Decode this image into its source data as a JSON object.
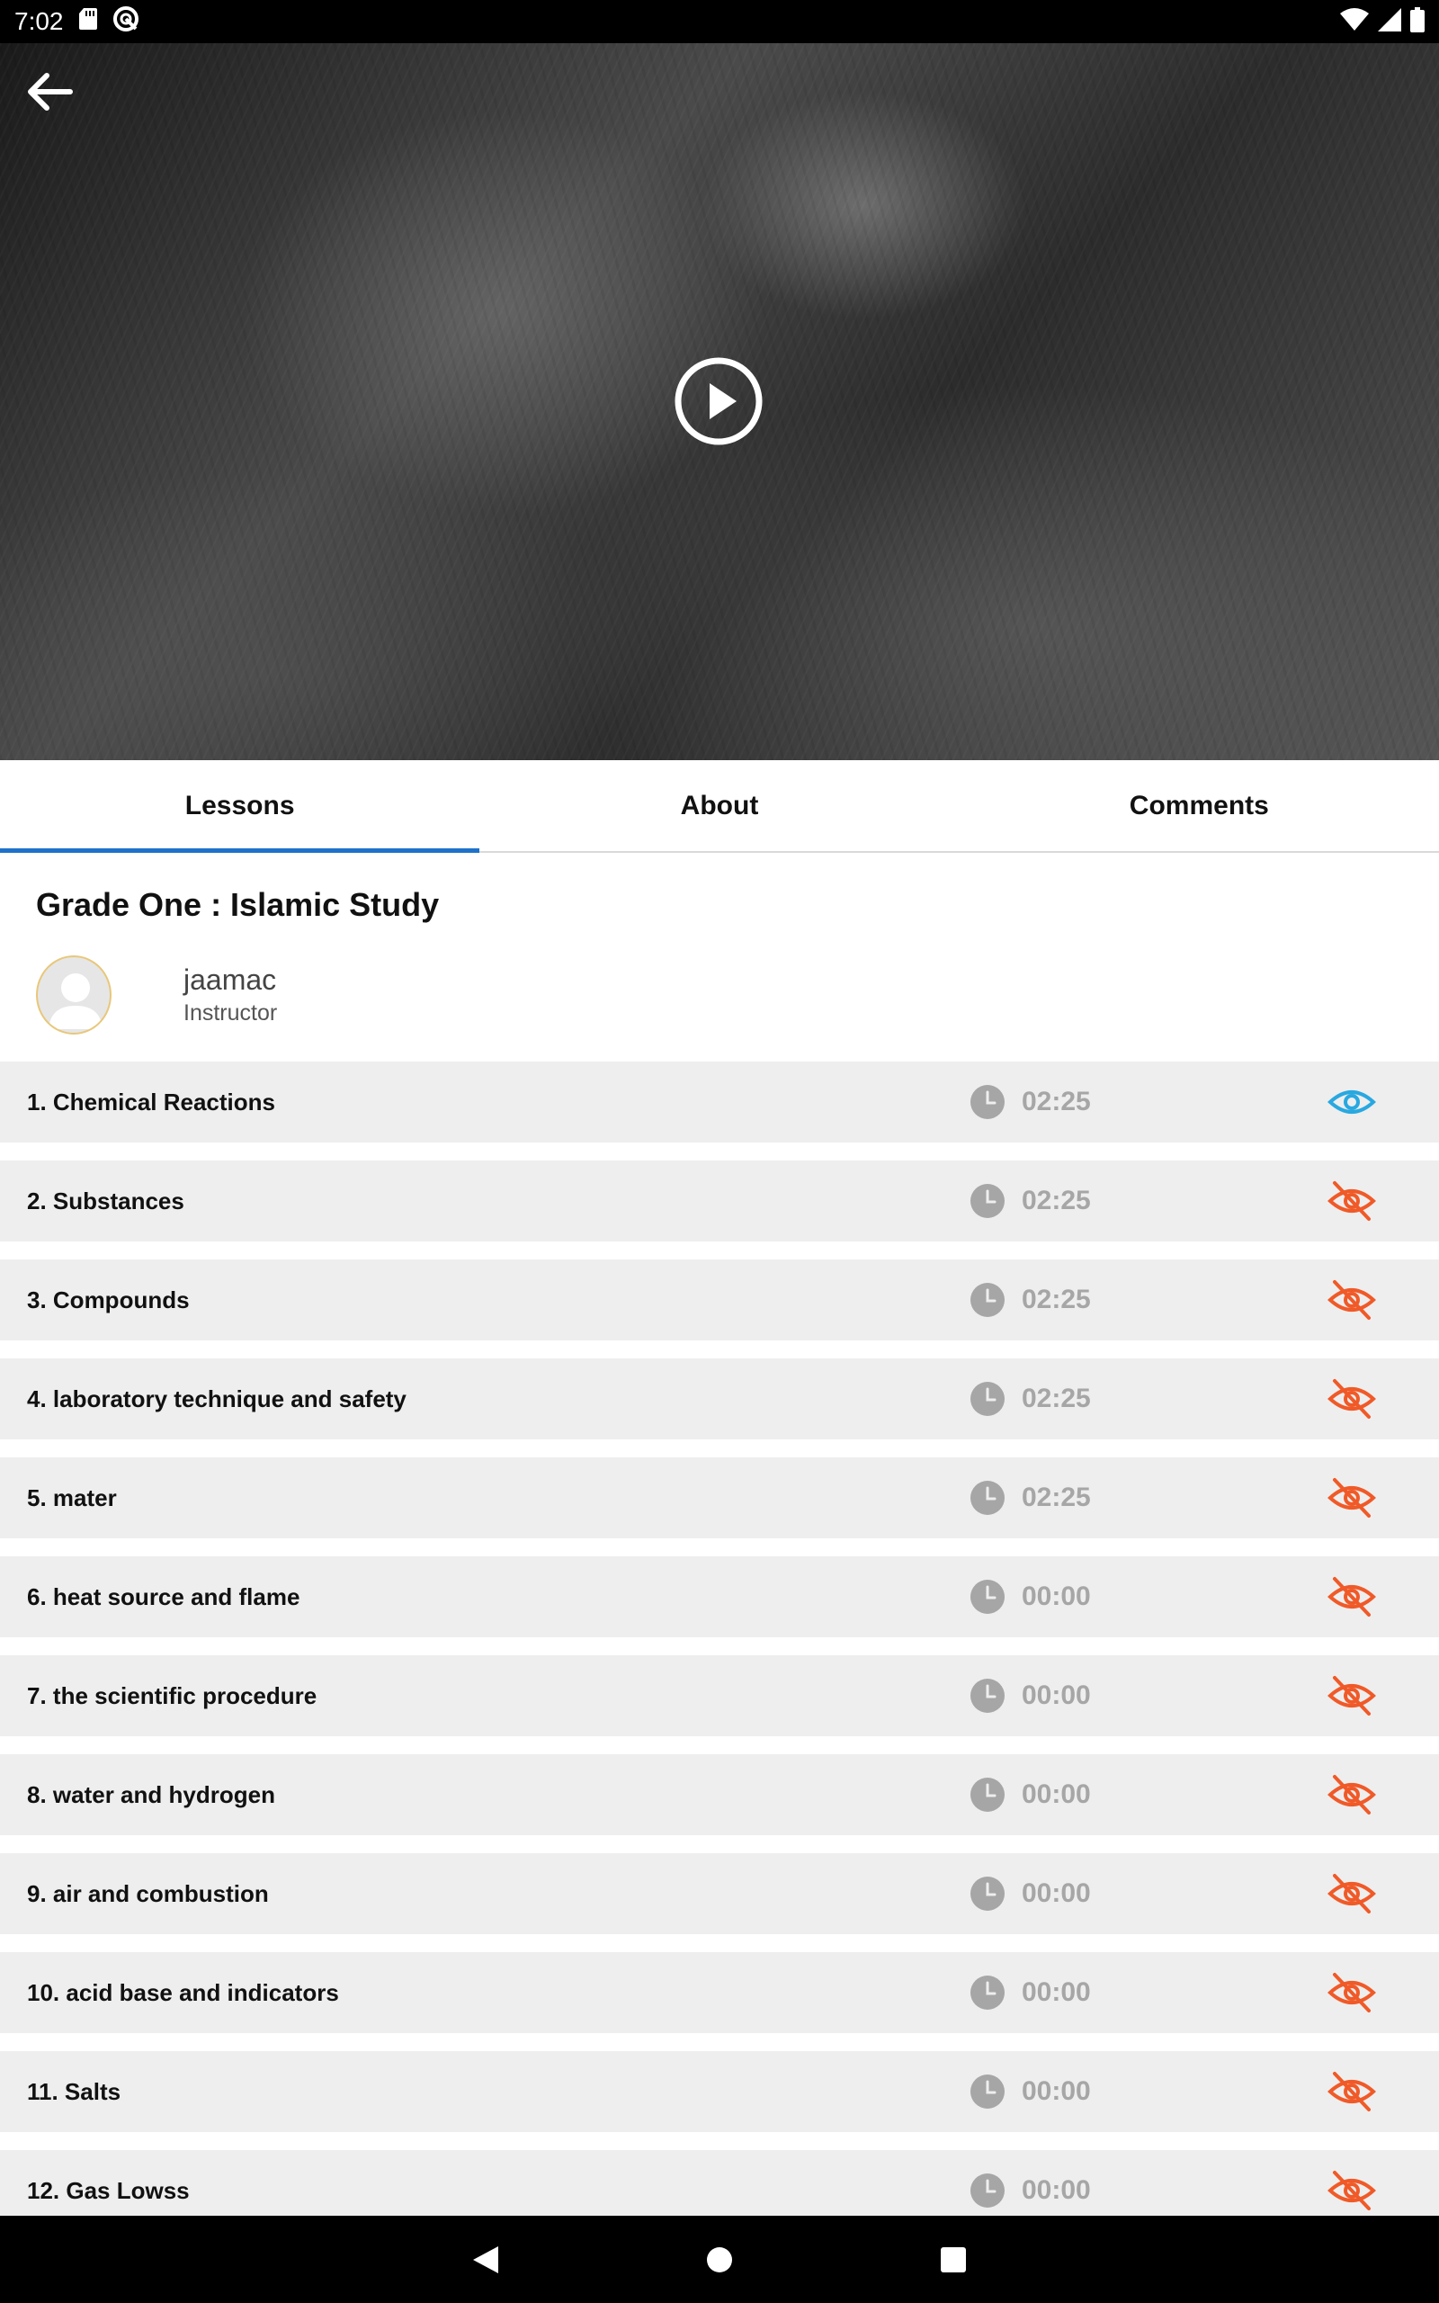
{
  "status_bar": {
    "time": "7:02",
    "icons": [
      "sd-card-icon",
      "sync-icon",
      "wifi-icon",
      "signal-icon",
      "battery-icon"
    ]
  },
  "hero": {
    "back_icon": "arrow-left-icon",
    "play_icon": "play-circle-icon"
  },
  "tabs": [
    {
      "label": "Lessons",
      "active": true
    },
    {
      "label": "About",
      "active": false
    },
    {
      "label": "Comments",
      "active": false
    }
  ],
  "course": {
    "title": "Grade One : Islamic Study",
    "instructor_name": "jaamac",
    "instructor_role": "Instructor"
  },
  "colors": {
    "accent": "#1e72c9",
    "eye_visible": "#29a8e0",
    "eye_locked": "#f05a28",
    "duration": "#a6a6a6",
    "row_bg": "#eeeeee"
  },
  "lessons": [
    {
      "title": "1. Chemical Reactions",
      "duration": "02:25",
      "status": "visible"
    },
    {
      "title": "2. Substances",
      "duration": "02:25",
      "status": "hidden"
    },
    {
      "title": "3. Compounds",
      "duration": "02:25",
      "status": "hidden"
    },
    {
      "title": "4. laboratory technique and safety",
      "duration": "02:25",
      "status": "hidden"
    },
    {
      "title": "5. mater",
      "duration": "02:25",
      "status": "hidden"
    },
    {
      "title": "6. heat source and flame",
      "duration": "00:00",
      "status": "hidden"
    },
    {
      "title": "7. the scientific procedure",
      "duration": "00:00",
      "status": "hidden"
    },
    {
      "title": "8. water and hydrogen",
      "duration": "00:00",
      "status": "hidden"
    },
    {
      "title": "9. air and combustion",
      "duration": "00:00",
      "status": "hidden"
    },
    {
      "title": "10. acid base and indicators",
      "duration": "00:00",
      "status": "hidden"
    },
    {
      "title": "11. Salts",
      "duration": "00:00",
      "status": "hidden"
    },
    {
      "title": "12. Gas Lowss",
      "duration": "00:00",
      "status": "hidden"
    }
  ],
  "nav_bar": {
    "back_icon": "nav-back-icon",
    "home_icon": "nav-home-icon",
    "recents_icon": "nav-recents-icon"
  }
}
